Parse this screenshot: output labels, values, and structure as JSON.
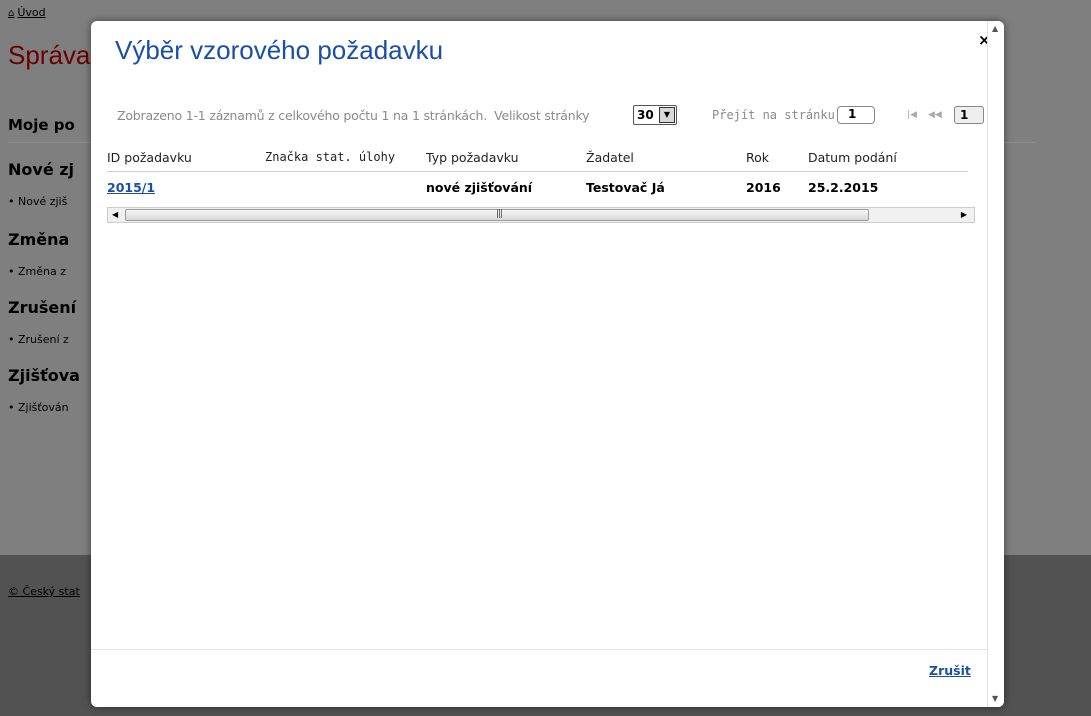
{
  "background": {
    "breadcrumb_home": "Úvod",
    "page_title_partial": "Správa",
    "sections": [
      {
        "heading": "Moje po",
        "items": []
      },
      {
        "heading": "Nové zj",
        "items": [
          "• Nové zjiš"
        ]
      },
      {
        "heading": "Změna",
        "items": [
          "• Změna z"
        ]
      },
      {
        "heading": "Zrušení",
        "items": [
          "• Zrušení z"
        ]
      },
      {
        "heading": "Zjišťova",
        "items": [
          "• Zjišťován"
        ]
      }
    ],
    "footer_copy": "© Český stat"
  },
  "modal": {
    "title": "Výběr vzorového požadavku",
    "close_glyph": "×",
    "pager": {
      "info_text": "Zobrazeno 1-1 záznamů z celkového počtu 1 na 1 stránkách.",
      "page_size_label": "Velikost stránky",
      "page_size_value": "30",
      "goto_label": "Přejít na stránku",
      "goto_value": "1",
      "current_page": "1"
    },
    "grid": {
      "columns": [
        "ID požadavku",
        "Značka stat. úlohy",
        "Typ požadavku",
        "Žadatel",
        "Rok",
        "Datum podání"
      ],
      "rows": [
        {
          "id": "2015/1",
          "znacka": "",
          "typ": "nové zjišťování",
          "zadatel": "Testovač Já",
          "rok": "2016",
          "datum": "25.2.2015"
        }
      ]
    },
    "cancel_label": "Zrušit"
  },
  "colors": {
    "accent": "#1a4fa8",
    "background_title": "#6a0000",
    "overlay": "#7f7f7f"
  }
}
